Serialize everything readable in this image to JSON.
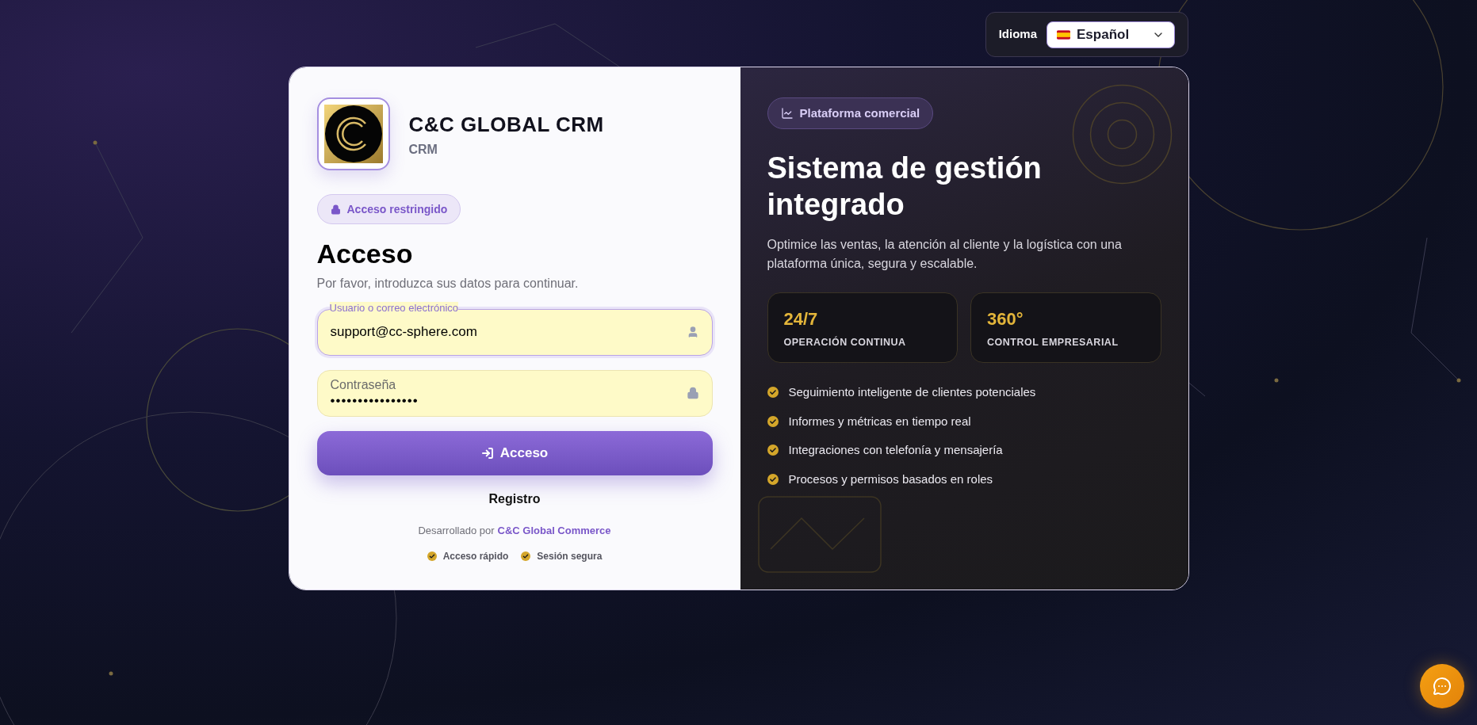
{
  "language": {
    "label": "Idioma",
    "value": "Español"
  },
  "brand": {
    "name": "C&C GLOBAL CRM",
    "subtitle": "CRM"
  },
  "badge": "Acceso restringido",
  "heading": "Acceso",
  "subheading": "Por favor, introduzca sus datos para continuar.",
  "fields": [
    {
      "kind": "user",
      "label": "Usuario o correo electrónico",
      "value": "support@cc-sphere.com",
      "focused": true
    },
    {
      "kind": "password",
      "label": "Contraseña",
      "value": "••••••••••••••••",
      "focused": false
    }
  ],
  "submit_button": "Acceso",
  "register_link": "Registro",
  "credit": {
    "text": "Desarrollado por",
    "link": "C&C Global Commerce"
  },
  "footer_features": [
    "Acceso rápido",
    "Sesión segura"
  ],
  "panel": {
    "badge": "Plataforma comercial",
    "title": "Sistema de gestión integrado",
    "description": "Optimice las ventas, la atención al cliente y la logística con una plataforma única, segura y escalable.",
    "stats": [
      {
        "value": "24/7",
        "label": "OPERACIÓN CONTINUA"
      },
      {
        "value": "360°",
        "label": "CONTROL EMPRESARIAL"
      }
    ],
    "features": [
      "Seguimiento inteligente de clientes potenciales",
      "Informes y métricas en tiempo real",
      "Integraciones con telefonía y mensajería",
      "Procesos y permisos basados en roles"
    ]
  }
}
